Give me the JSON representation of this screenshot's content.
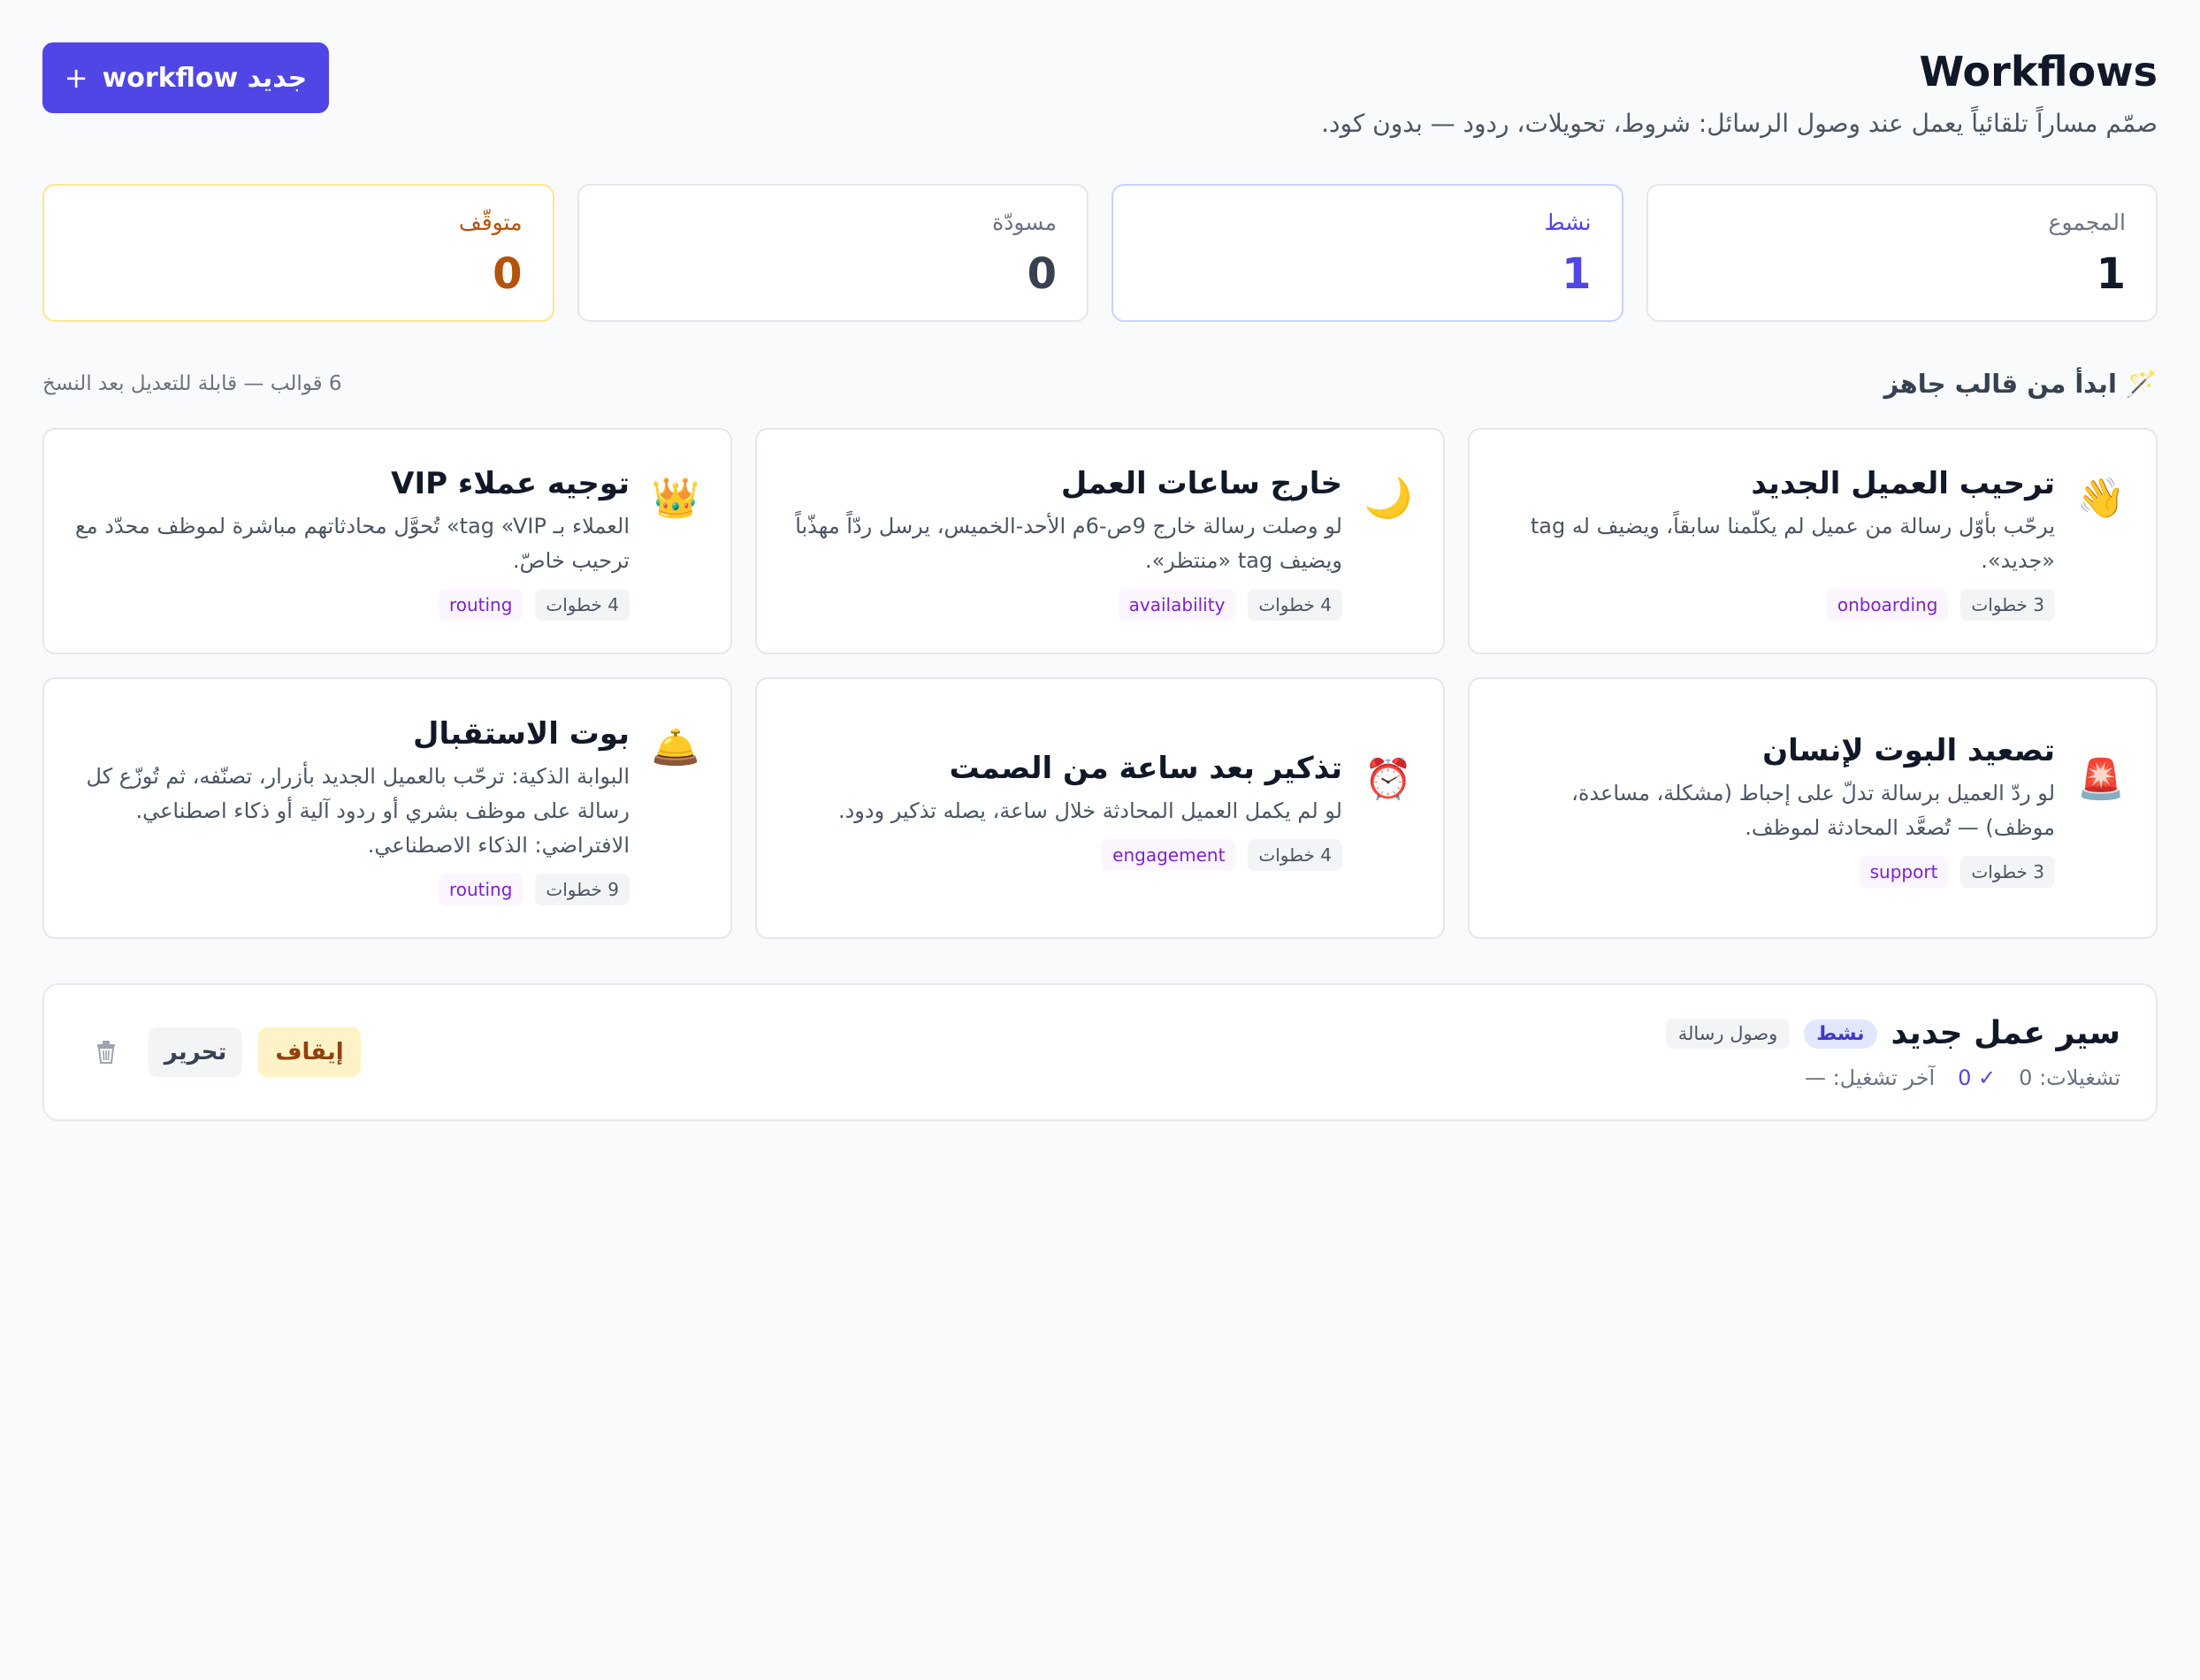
{
  "header": {
    "title": "Workflows",
    "subtitle": "صمّم مساراً تلقائياً يعمل عند وصول الرسائل: شروط، تحويلات، ردود — بدون كود.",
    "new_button_plus": "+",
    "new_button_label": "جديد workflow"
  },
  "stats": {
    "total": {
      "label": "المجموع",
      "value": "1"
    },
    "active": {
      "label": "نشط",
      "value": "1"
    },
    "draft": {
      "label": "مسودّة",
      "value": "0"
    },
    "paused": {
      "label": "متوقّف",
      "value": "0"
    }
  },
  "templates": {
    "icon": "🪄",
    "title": "ابدأ من قالب جاهز",
    "note": "6 قوالب — قابلة للتعديل بعد النسخ",
    "items": [
      {
        "icon": "👋",
        "icon_name": "waving-hand-icon",
        "title": "ترحيب العميل الجديد",
        "desc": "يرحّب بأوّل رسالة من عميل لم يكلّمنا سابقاً، ويضيف له tag «جديد».",
        "steps": "3 خطوات",
        "tag": "onboarding"
      },
      {
        "icon": "🌙",
        "icon_name": "moon-icon",
        "title": "خارج ساعات العمل",
        "desc": "لو وصلت رسالة خارج 9ص-6م الأحد-الخميس، يرسل ردّاً مهذّباً ويضيف tag «منتظر».",
        "steps": "4 خطوات",
        "tag": "availability"
      },
      {
        "icon": "👑",
        "icon_name": "crown-icon",
        "title": "توجيه عملاء VIP",
        "desc": "العملاء بـ tag «VIP» تُحوَّل محادثاتهم مباشرة لموظف محدّد مع ترحيب خاصّ.",
        "steps": "4 خطوات",
        "tag": "routing"
      },
      {
        "icon": "🚨",
        "icon_name": "siren-icon",
        "title": "تصعيد البوت لإنسان",
        "desc": "لو ردّ العميل برسالة تدلّ على إحباط (مشكلة، مساعدة، موظف) — تُصعَّد المحادثة لموظف.",
        "steps": "3 خطوات",
        "tag": "support"
      },
      {
        "icon": "⏰",
        "icon_name": "alarm-clock-icon",
        "title": "تذكير بعد ساعة من الصمت",
        "desc": "لو لم يكمل العميل المحادثة خلال ساعة، يصله تذكير ودود.",
        "steps": "4 خطوات",
        "tag": "engagement"
      },
      {
        "icon": "🛎️",
        "icon_name": "bellhop-bell-icon",
        "title": "بوت الاستقبال",
        "desc": "البوابة الذكية: ترحّب بالعميل الجديد بأزرار، تصنّفه، ثم تُوزّع كل رسالة على موظف بشري أو ردود آلية أو ذكاء اصطناعي. الافتراضي: الذكاء الاصطناعي.",
        "steps": "9 خطوات",
        "tag": "routing"
      }
    ]
  },
  "workflow": {
    "name": "سير عمل جديد",
    "status": "نشط",
    "trigger": "وصول رسالة",
    "runs": "تشغيلات: 0",
    "success": "✓ 0",
    "last_run": "آخر تشغيل: —",
    "pause_label": "إيقاف",
    "edit_label": "تحرير"
  },
  "colors": {
    "accent": "#4f46e5",
    "paused": "#b45309",
    "tag_text": "#7e22ce",
    "background": "#f9fafb"
  }
}
